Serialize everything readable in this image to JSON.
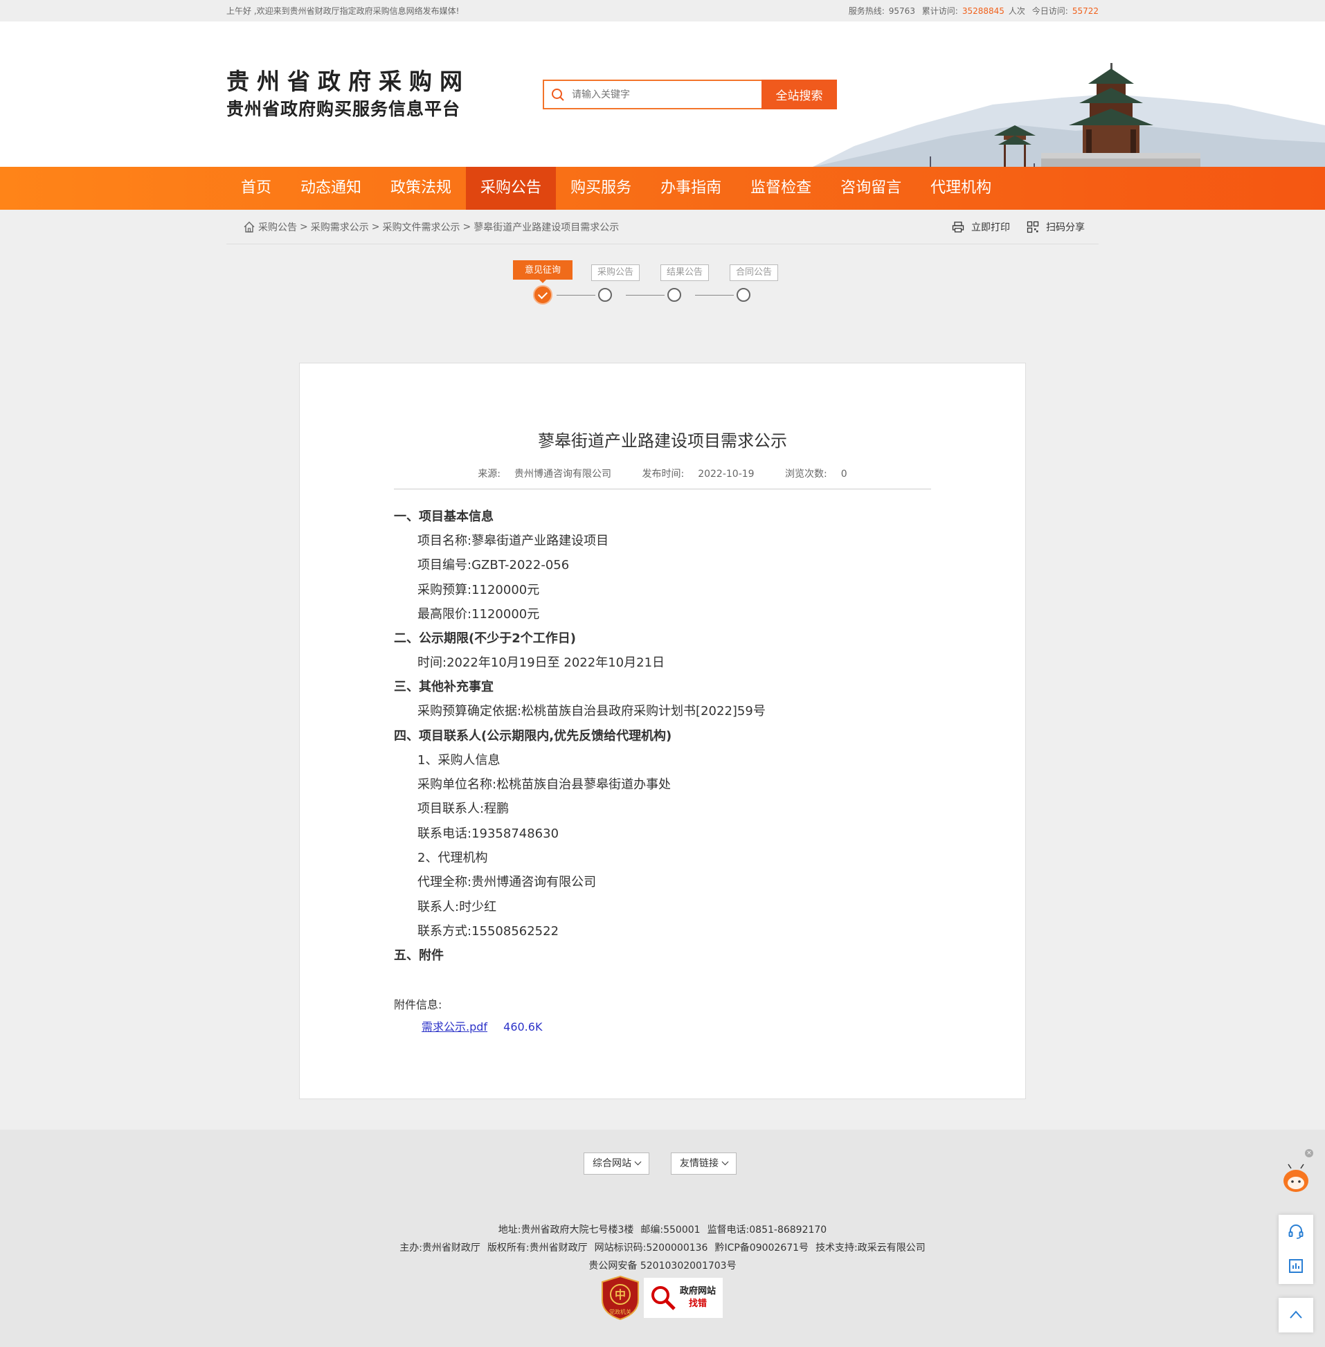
{
  "topbar": {
    "welcome": "上午好 ,欢迎来到贵州省财政厅指定政府采购信息网络发布媒体!",
    "hotline_label": "服务热线:",
    "hotline": "95763",
    "total_label": "累计访问:",
    "total": "35288845",
    "total_unit": "人次",
    "today_label": "今日访问:",
    "today": "55722"
  },
  "header": {
    "logo_line1": "贵州省政府采购网",
    "logo_line2": "贵州省政府购买服务信息平台",
    "search_placeholder": "请输入关键字",
    "search_button": "全站搜索"
  },
  "nav": {
    "items": [
      "首页",
      "动态通知",
      "政策法规",
      "采购公告",
      "购买服务",
      "办事指南",
      "监督检查",
      "咨询留言",
      "代理机构"
    ],
    "active_index": 3
  },
  "breadcrumb": {
    "items": [
      "采购公告",
      "采购需求公示",
      "采购文件需求公示",
      "蓼皋街道产业路建设项目需求公示"
    ],
    "separator": ">",
    "print": "立即打印",
    "share": "扫码分享"
  },
  "steps": [
    "意见征询",
    "采购公告",
    "结果公告",
    "合同公告"
  ],
  "article": {
    "title": "蓼皋街道产业路建设项目需求公示",
    "source_label": "来源:",
    "source": "贵州博通咨询有限公司",
    "date_label": "发布时间:",
    "date": "2022-10-19",
    "views_label": "浏览次数:",
    "views": "0",
    "sections": [
      {
        "h": "一、项目基本信息",
        "lines": [
          "项目名称:蓼皋街道产业路建设项目",
          "项目编号:GZBT-2022-056",
          "采购预算:1120000元",
          "最高限价:1120000元"
        ]
      },
      {
        "h": "二、公示期限(不少于2个工作日)",
        "lines": [
          "时间:2022年10月19日至 2022年10月21日"
        ]
      },
      {
        "h": "三、其他补充事宜",
        "lines": [
          "采购预算确定依据:松桃苗族自治县政府采购计划书[2022]59号"
        ]
      },
      {
        "h": "四、项目联系人(公示期限内,优先反馈给代理机构)",
        "lines": [
          "1、采购人信息",
          "采购单位名称:松桃苗族自治县蓼皋街道办事处",
          "项目联系人:程鹏",
          "联系电话:19358748630",
          "2、代理机构",
          "代理全称:贵州博通咨询有限公司",
          "联系人:时少红",
          "联系方式:15508562522"
        ]
      },
      {
        "h": "五、附件",
        "lines": []
      }
    ],
    "attachment_label": "附件信息:",
    "attachment_name": "需求公示.pdf",
    "attachment_size": "460.6K"
  },
  "footer": {
    "select1": "综合网站",
    "select2": "友情链接",
    "line1": [
      "地址:贵州省政府大院七号楼3楼",
      "邮编:550001",
      "监督电话:0851-86892170"
    ],
    "line2": [
      "主办:贵州省财政厅",
      "版权所有:贵州省财政厅",
      "网站标识码:5200000136",
      "黔ICP备09002671号",
      "技术支持:政采云有限公司"
    ],
    "line3": "贵公网安备 52010302001703号",
    "badge1": "党政机关",
    "badge2_l1": "政府网站",
    "badge2_l2": "找错"
  },
  "colors": {
    "accent": "#f06b1a",
    "nav_active": "#e04610",
    "link": "#2c33c8"
  }
}
